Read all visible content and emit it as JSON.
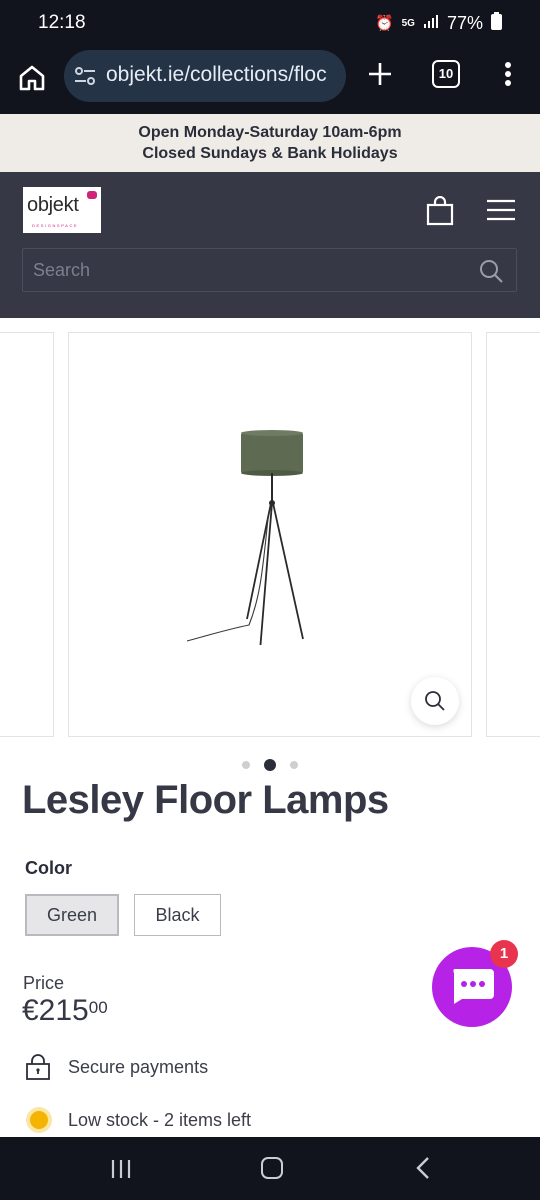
{
  "status_bar": {
    "time": "12:18",
    "network": "5G",
    "battery": "77%"
  },
  "browser": {
    "url": "objekt.ie/collections/floc",
    "tab_count": "10"
  },
  "announcement": {
    "line1": "Open Monday-Saturday 10am-6pm",
    "line2": "Closed Sundays & Bank Holidays"
  },
  "header": {
    "logo_text": "objekt",
    "logo_subtext": "DESIGNSPACE",
    "search_placeholder": "Search"
  },
  "gallery": {
    "slide_count": 3,
    "active_slide": 2
  },
  "product": {
    "title": "Lesley Floor Lamps",
    "option_label": "Color",
    "options": [
      "Green",
      "Black"
    ],
    "selected_option": "Green",
    "price_label": "Price",
    "price_main": "€215",
    "price_cents": "00",
    "features": {
      "secure": "Secure payments",
      "stock": "Low stock - 2 items left"
    }
  },
  "chat": {
    "badge_count": "1"
  },
  "colors": {
    "header_bg": "#363846",
    "announcement_bg": "#efece7",
    "chat_bg": "#b623e6",
    "badge_bg": "#e8344e",
    "stock_dot": "#f5b400",
    "lamp_shade": "#5e6a52"
  }
}
